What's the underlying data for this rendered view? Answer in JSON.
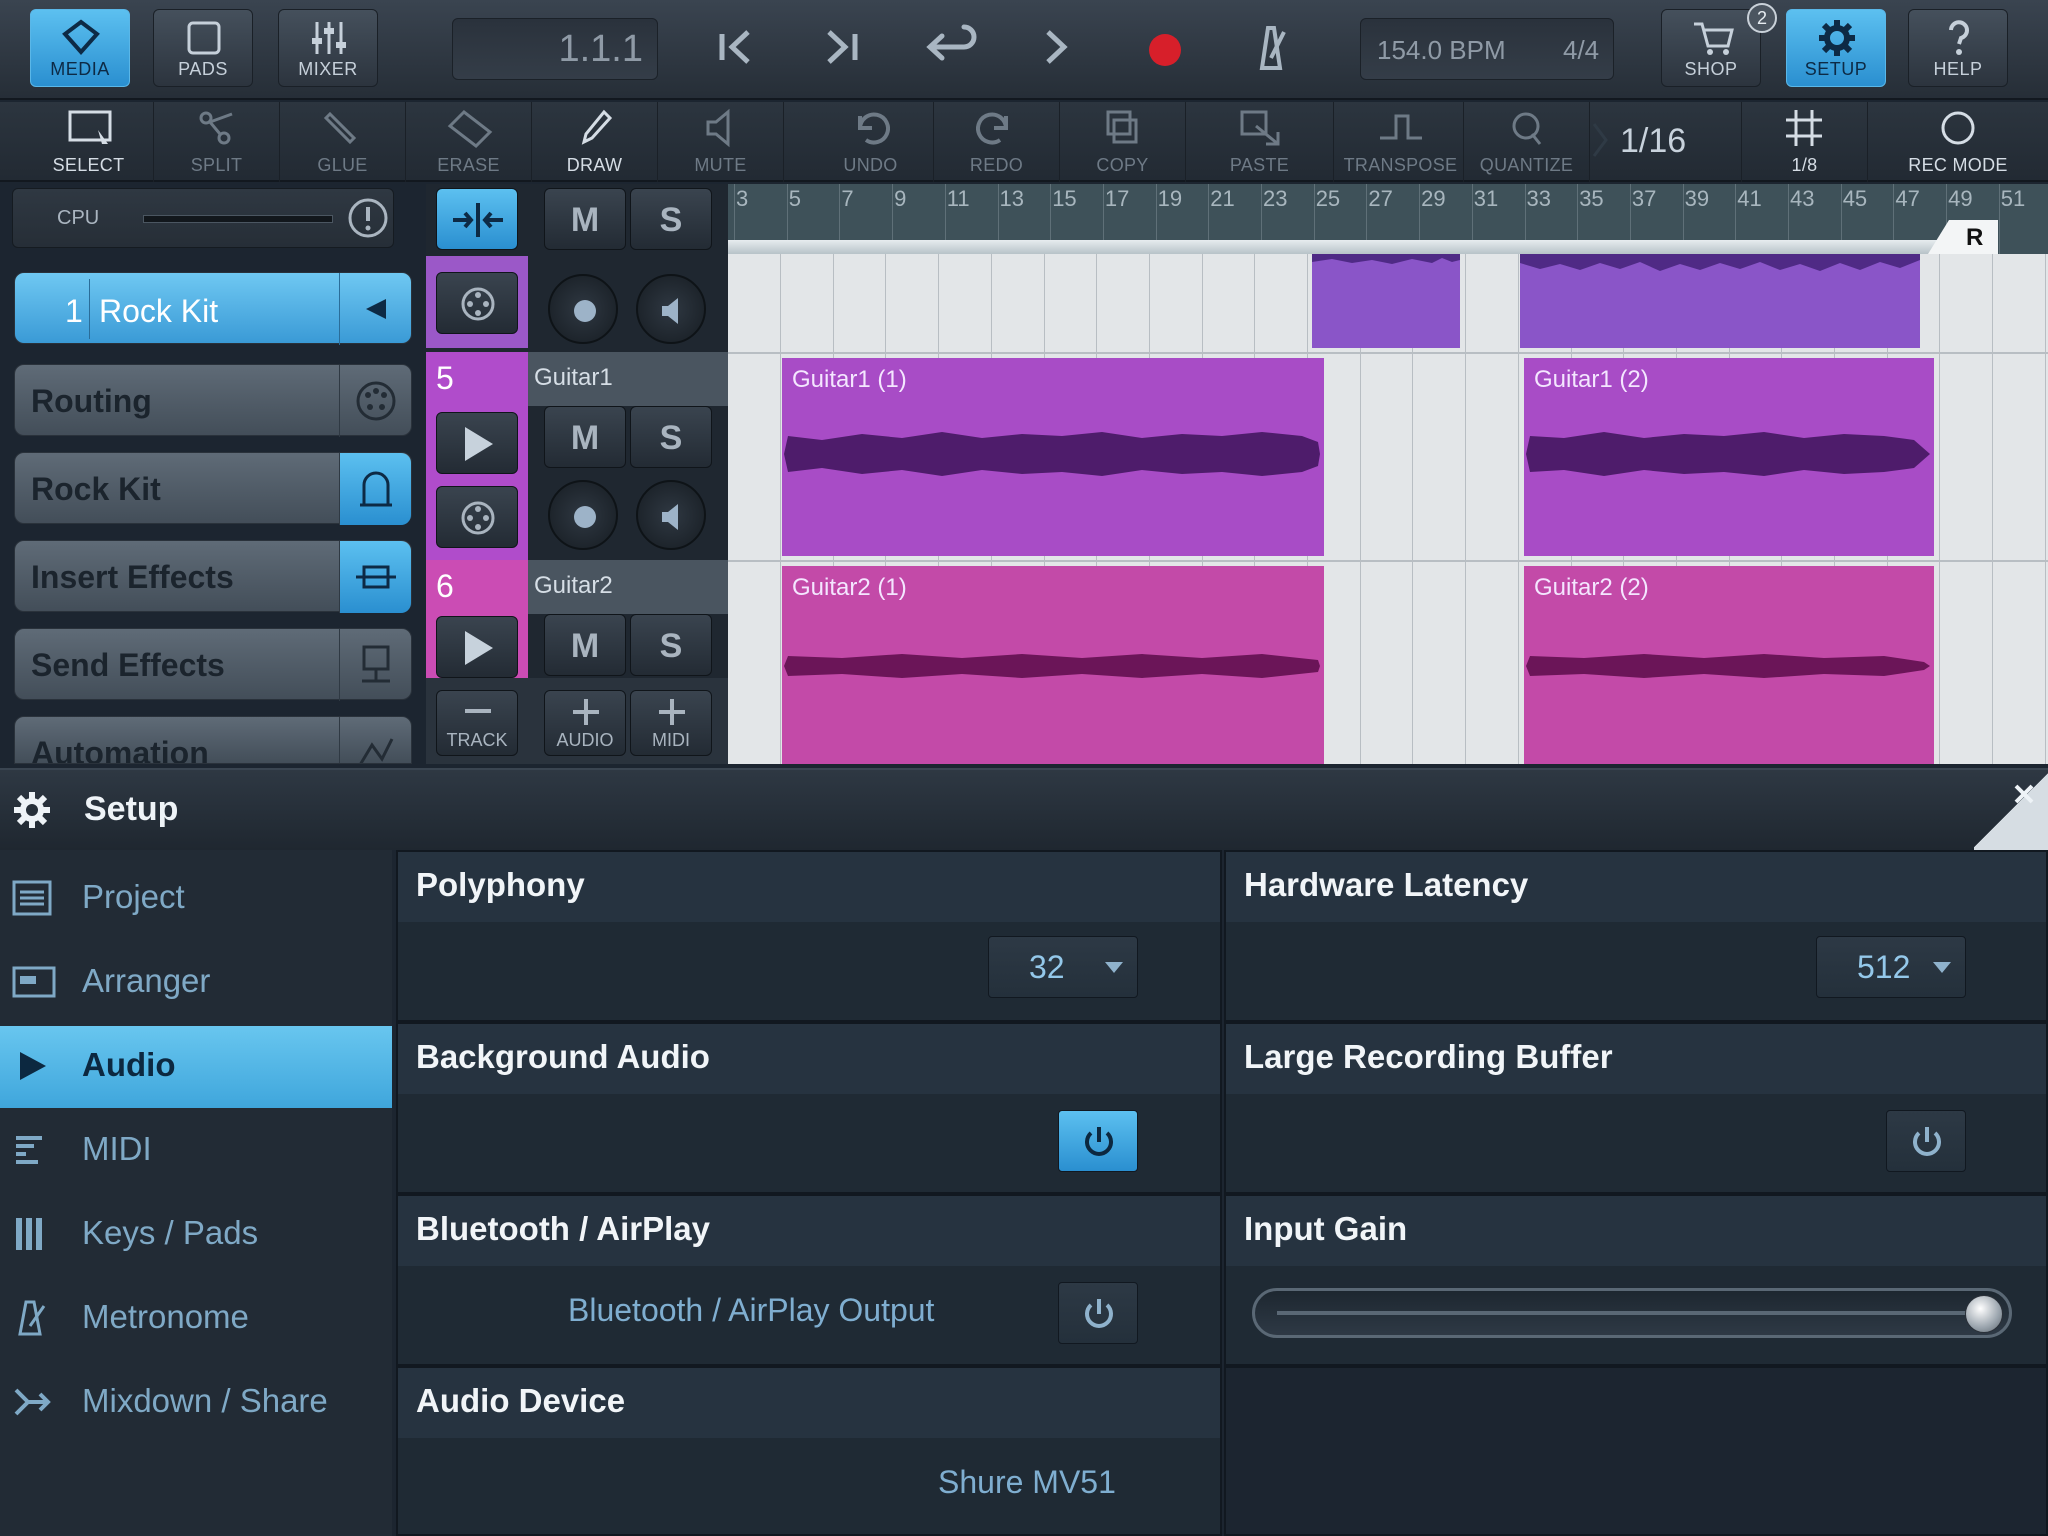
{
  "topbar": {
    "media": "MEDIA",
    "pads": "PADS",
    "mixer": "MIXER",
    "position": "1.1.1",
    "bpm": "154.0 BPM",
    "time_signature": "4/4",
    "shop": "SHOP",
    "shop_badge": "2",
    "setup": "SETUP",
    "help": "HELP"
  },
  "tools": {
    "select": "SELECT",
    "split": "SPLIT",
    "glue": "GLUE",
    "erase": "ERASE",
    "draw": "DRAW",
    "mute": "MUTE",
    "undo": "UNDO",
    "redo": "REDO",
    "copy": "COPY",
    "paste": "PASTE",
    "transpose": "TRANSPOSE",
    "quantize": "QUANTIZE",
    "quantize_value": "1/16",
    "grid_value": "1/8",
    "rec_mode": "REC MODE"
  },
  "cpu": {
    "label": "CPU",
    "load": 0.0
  },
  "instrument_panel": {
    "selected_number": "1",
    "selected_name": "Rock Kit",
    "items": [
      "Routing",
      "Rock Kit",
      "Insert Effects",
      "Send Effects",
      "Automation"
    ]
  },
  "track_controls": {
    "mute": "M",
    "solo": "S",
    "add_track": "TRACK",
    "add_audio": "AUDIO",
    "add_midi": "MIDI"
  },
  "tracks": [
    {
      "number": "5",
      "name": "Guitar1",
      "color": "#b04ccb"
    },
    {
      "number": "6",
      "name": "Guitar2",
      "color": "#cb4cb4"
    }
  ],
  "ruler": {
    "bars": [
      "3",
      "5",
      "7",
      "9",
      "11",
      "13",
      "15",
      "17",
      "19",
      "21",
      "23",
      "25",
      "27",
      "29",
      "31",
      "33",
      "35",
      "37",
      "39",
      "41",
      "43",
      "45",
      "47",
      "49",
      "51"
    ],
    "loop_end_label": "R"
  },
  "clips": {
    "g1a": "Guitar1 (1)",
    "g1b": "Guitar1 (2)",
    "g2a": "Guitar2 (1)",
    "g2b": "Guitar2 (2)"
  },
  "setup": {
    "title": "Setup",
    "nav": [
      "Project",
      "Arranger",
      "Audio",
      "MIDI",
      "Keys / Pads",
      "Metronome",
      "Mixdown / Share"
    ],
    "selected": "Audio",
    "polyphony": {
      "label": "Polyphony",
      "value": "32"
    },
    "hardware_latency": {
      "label": "Hardware Latency",
      "value": "512"
    },
    "background_audio": {
      "label": "Background Audio",
      "enabled": true
    },
    "large_recording_buffer": {
      "label": "Large Recording Buffer",
      "enabled": false
    },
    "bluetooth": {
      "label": "Bluetooth / AirPlay",
      "option": "Bluetooth / AirPlay Output",
      "enabled": false
    },
    "input_gain": {
      "label": "Input Gain",
      "value": 1.0
    },
    "audio_device": {
      "label": "Audio Device",
      "value": "Shure MV51"
    }
  }
}
